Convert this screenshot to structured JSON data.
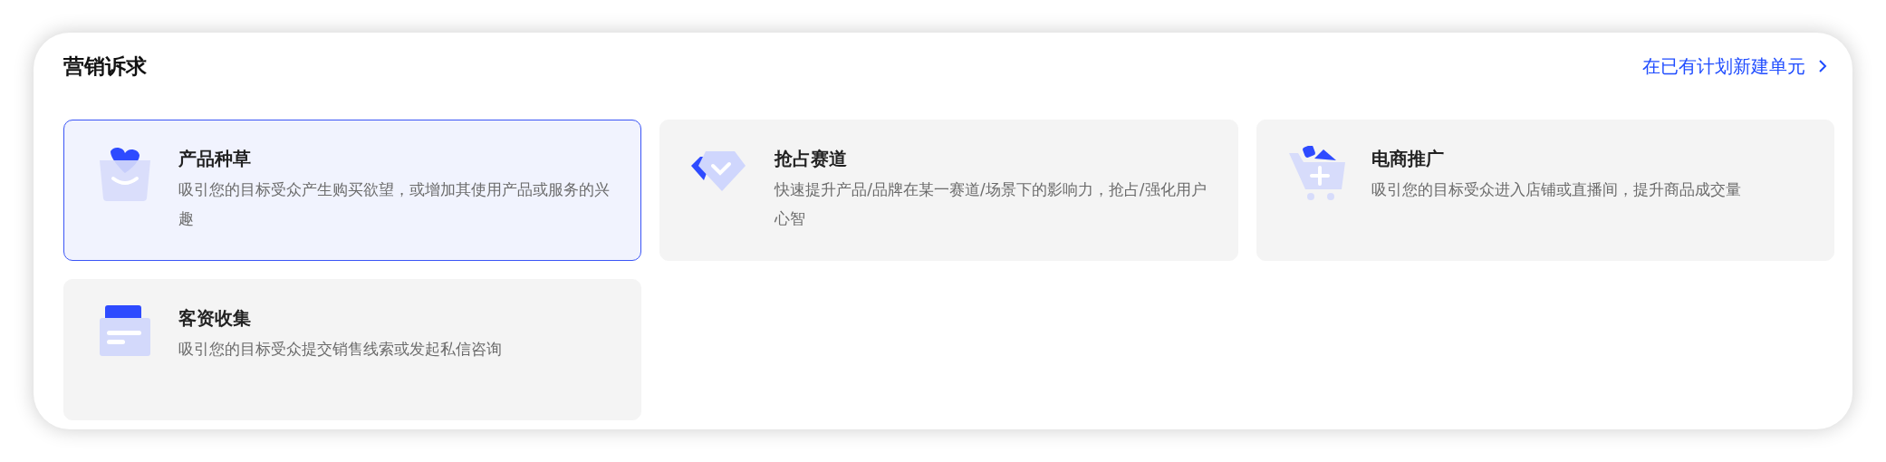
{
  "section": {
    "title": "营销诉求",
    "link": "在已有计划新建单元"
  },
  "options": [
    {
      "kind": "bag",
      "title": "产品种草",
      "description": "吸引您的目标受众产生购买欲望，或增加其使用产品或服务的兴趣",
      "selected": true
    },
    {
      "kind": "diamond",
      "title": "抢占赛道",
      "description": "快速提升产品/品牌在某一赛道/场景下的影响力，抢占/强化用户心智",
      "selected": false
    },
    {
      "kind": "cart",
      "title": "电商推广",
      "description": "吸引您的目标受众进入店铺或直播间，提升商品成交量",
      "selected": false
    },
    {
      "kind": "folder",
      "title": "客资收集",
      "description": "吸引您的目标受众提交销售线索或发起私信咨询",
      "selected": false
    }
  ]
}
